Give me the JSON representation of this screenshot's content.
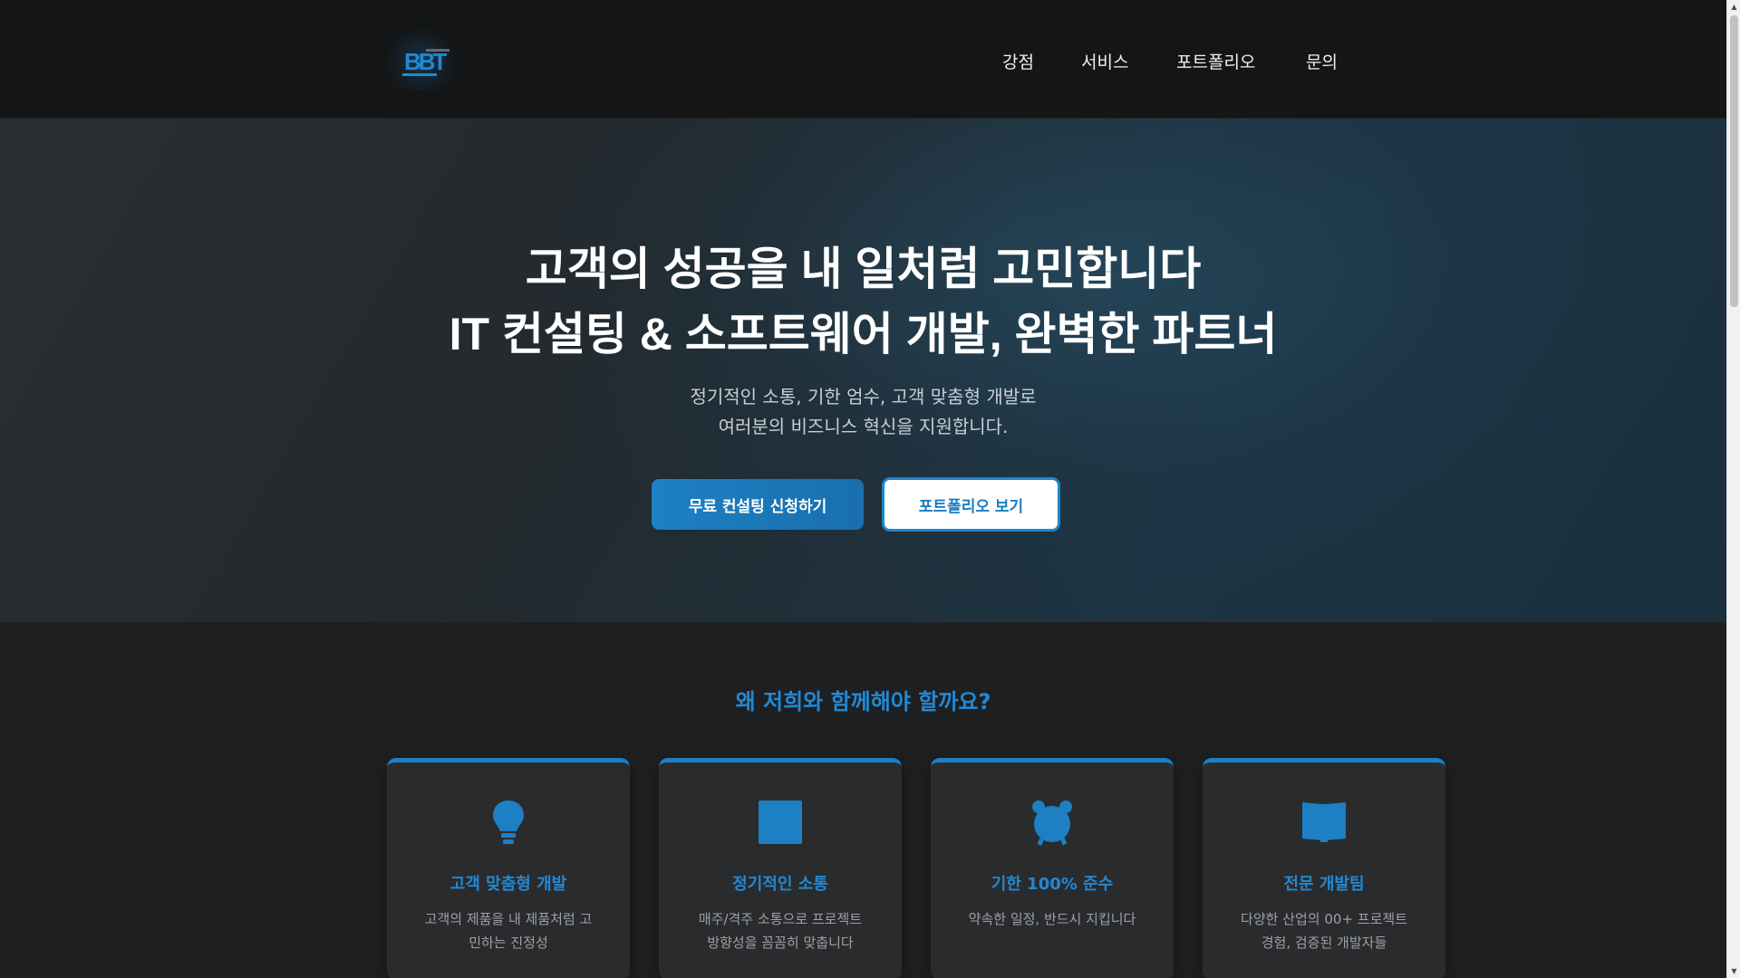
{
  "header": {
    "logo_alt": "BBT",
    "nav": [
      {
        "label": "강점"
      },
      {
        "label": "서비스"
      },
      {
        "label": "포트폴리오"
      },
      {
        "label": "문의"
      }
    ]
  },
  "hero": {
    "title_line1": "고객의 성공을 내 일처럼 고민합니다",
    "title_line2": "IT 컨설팅 & 소프트웨어 개발, 완벽한 파트너",
    "subtitle_line1": "정기적인 소통, 기한 엄수, 고객 맞춤형 개발로",
    "subtitle_line2": "여러분의 비즈니스 혁신을 지원합니다.",
    "primary_button": "무료 컨설팅 신청하기",
    "secondary_button": "포트폴리오 보기"
  },
  "features": {
    "title": "왜 저희와 함께해야 할까요?",
    "cards": [
      {
        "icon": "lightbulb-icon",
        "title": "고객 맞춤형 개발",
        "desc_line1": "고객의 제품을 내 제품처럼 고",
        "desc_line2": "민하는 진정성"
      },
      {
        "icon": "square-icon",
        "title": "정기적인 소통",
        "desc_line1": "매주/격주 소통으로 프로젝트",
        "desc_line2": "방향성을 꼼꼼히 맞춥니다"
      },
      {
        "icon": "alarm-clock-icon",
        "title": "기한 100% 준수",
        "desc_line1": "약속한 일정, 반드시 지킵니다",
        "desc_line2": ""
      },
      {
        "icon": "book-icon",
        "title": "전문 개발팀",
        "desc_line1": "다양한 산업의 00+ 프로젝트",
        "desc_line2": "경험, 검증된 개발자들"
      }
    ]
  },
  "colors": {
    "accent": "#1d7fc4",
    "header_bg": "#141516",
    "body_bg": "#1e1f21",
    "card_bg": "#2a2b2d"
  }
}
